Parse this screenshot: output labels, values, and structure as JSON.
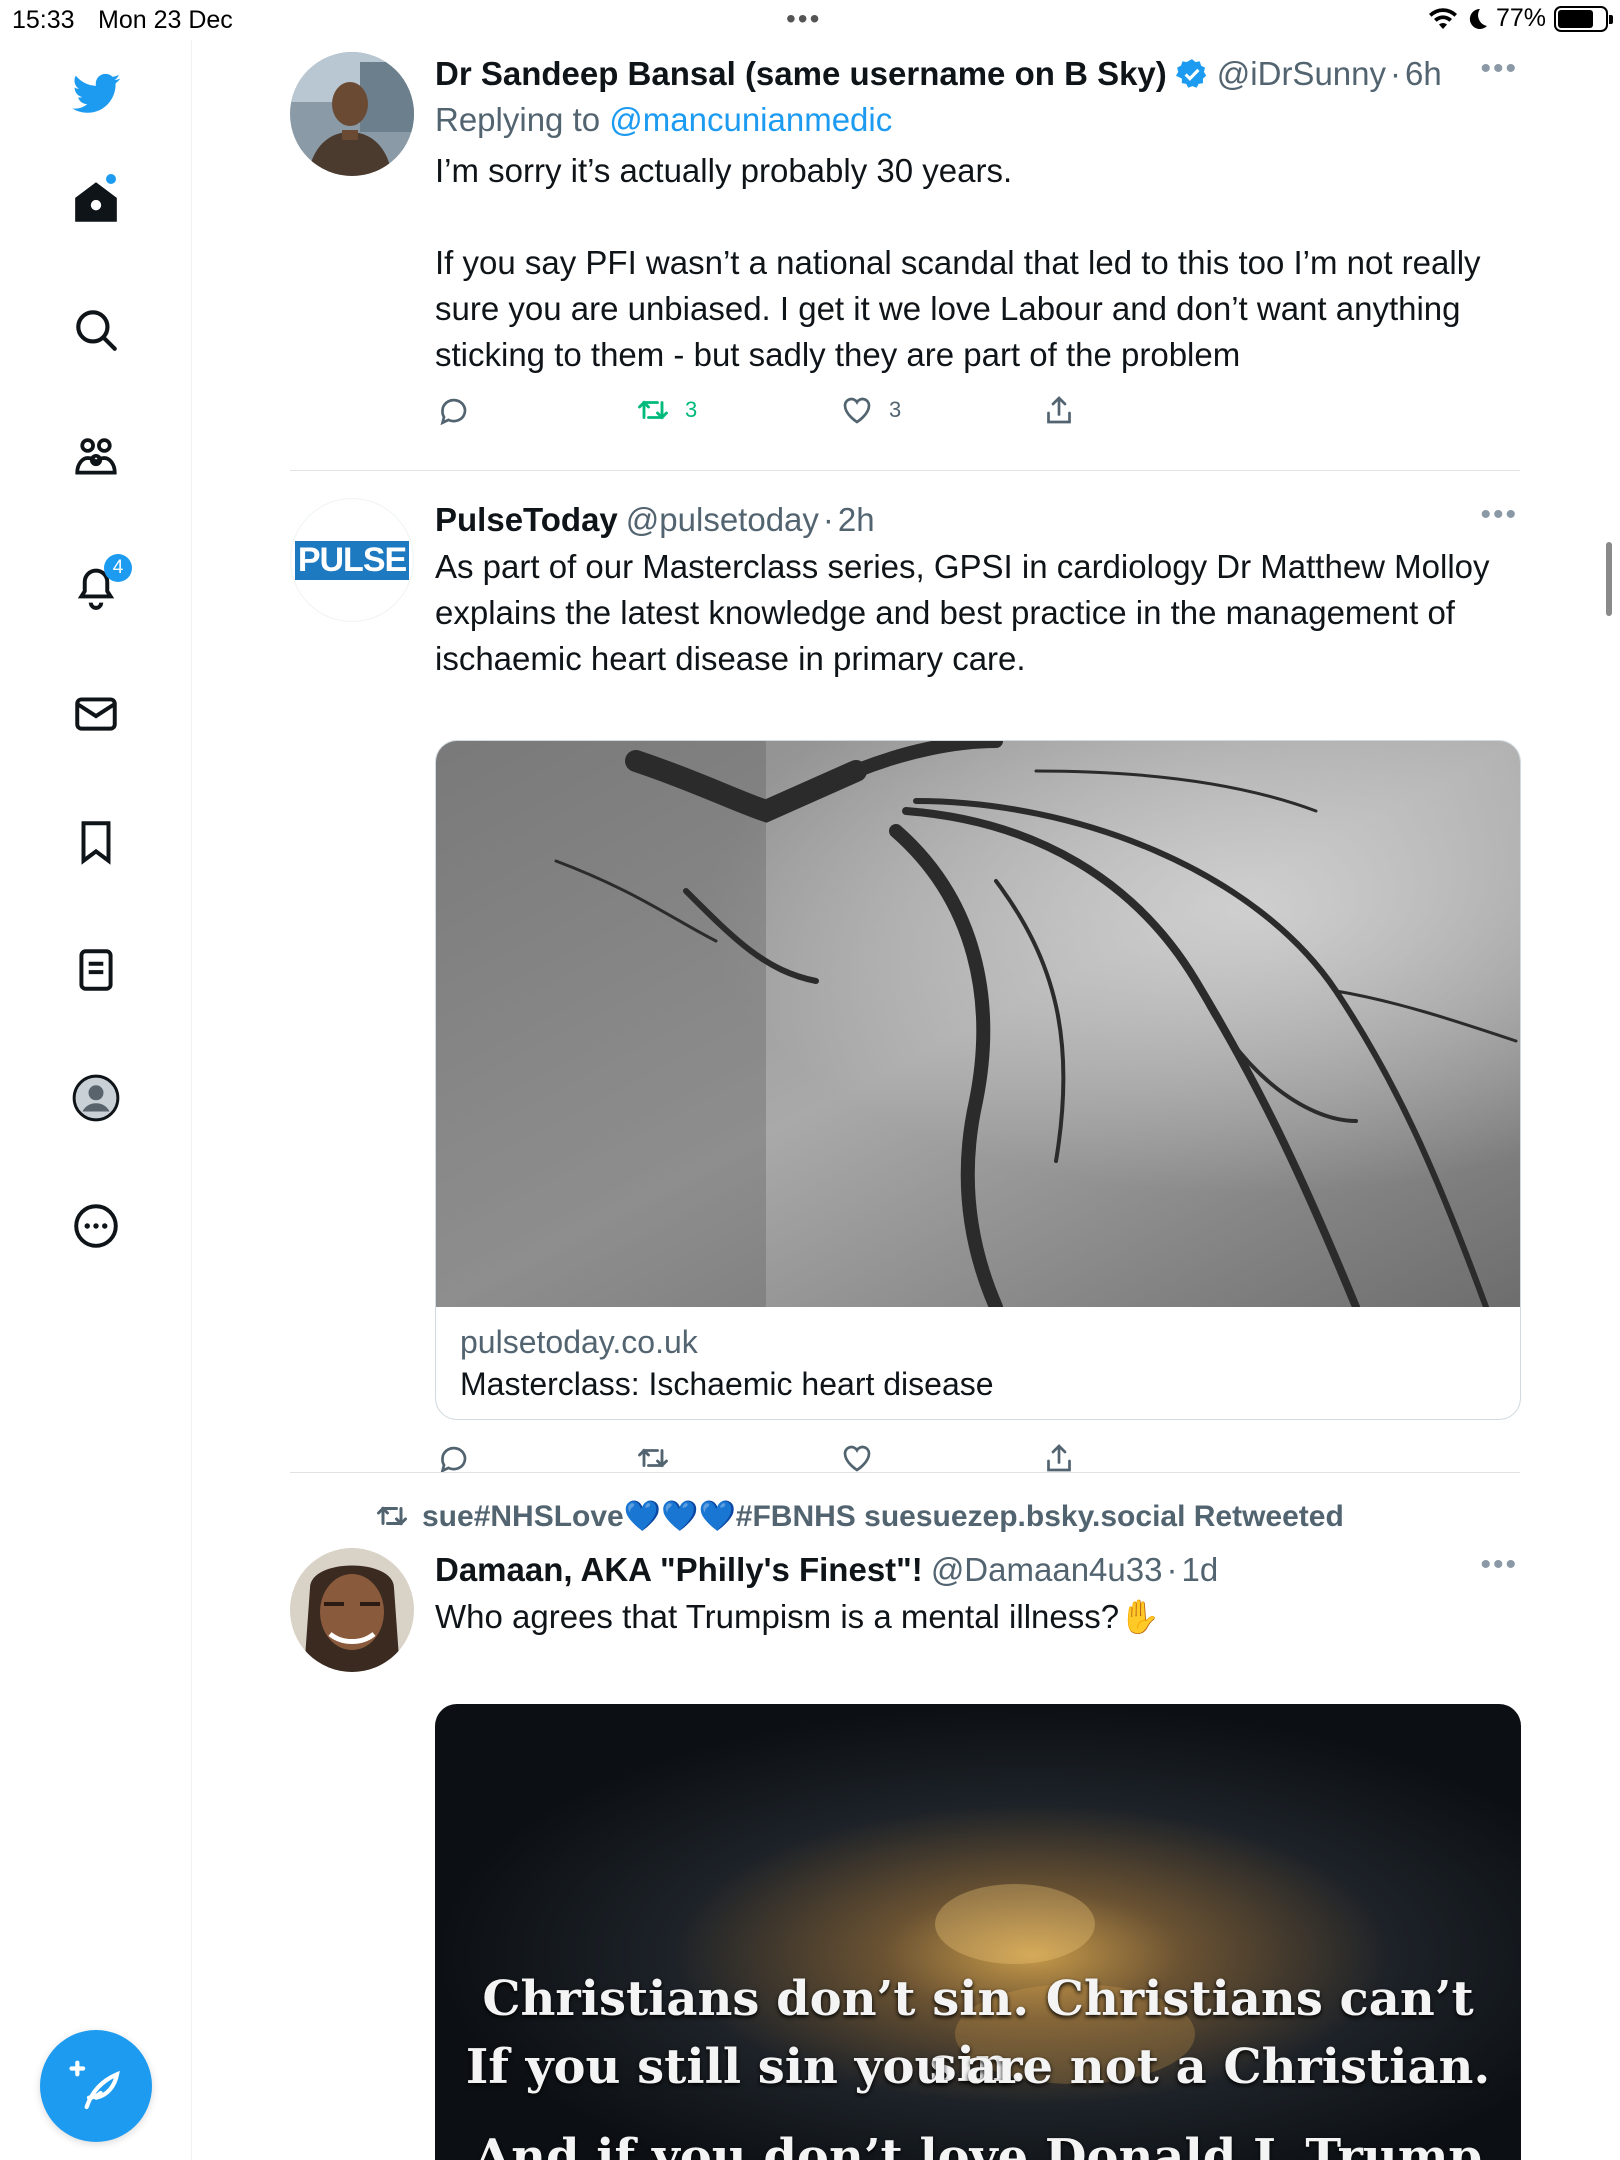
{
  "status_bar": {
    "time": "15:33",
    "date": "Mon 23 Dec",
    "battery": "77%",
    "battery_level": 0.77
  },
  "sidebar": {
    "notifications_badge": "4",
    "items": [
      "twitter-logo",
      "home",
      "search",
      "communities",
      "notifications",
      "messages",
      "bookmarks",
      "lists",
      "profile",
      "more"
    ]
  },
  "tweets": [
    {
      "name": "Dr Sandeep Bansal (same username on B Sky)",
      "verified": true,
      "handle": "@iDrSunny",
      "separator": "·",
      "time": "6h",
      "replying_prefix": "Replying to",
      "replying_to": "@mancunianmedic",
      "text": "I’m sorry it’s actually probably 30 years.\n\nIf you say PFI wasn’t a national scandal that led to this too I’m not really sure you are unbiased. I get it we love Labour and don’t want anything sticking to them - but sadly they are part of the problem",
      "retweets": "3",
      "likes": "3"
    },
    {
      "name": "PulseToday",
      "handle": "@pulsetoday",
      "separator": "·",
      "time": "2h",
      "avatar_text": "PULSE",
      "text": "As part of our Masterclass series, GPSI in cardiology Dr Matthew Molloy explains the latest knowledge and best practice in the management of ischaemic heart disease in primary care.",
      "card_domain": "pulsetoday.co.uk",
      "card_title": "Masterclass: Ischaemic heart disease"
    },
    {
      "retweeted_by": "sue#NHSLove💙💙💙#FBNHS suesuezep.bsky.social Retweeted",
      "name": "Damaan, AKA \"Philly's Finest\"!",
      "handle": "@Damaan4u33",
      "separator": "·",
      "time": "1d",
      "text": "Who agrees that Trumpism is a mental illness?✋",
      "media_text_line1": "Christians don’t sin. Christians can’t sin.",
      "media_text_line2": "If you still sin you are not a Christian.",
      "media_text_line3": "And if you don’t love Donald J. Trump"
    }
  ],
  "colors": {
    "accent": "#1d9bf0",
    "retweet_green": "#00ba7c",
    "secondary_text": "#536471"
  }
}
